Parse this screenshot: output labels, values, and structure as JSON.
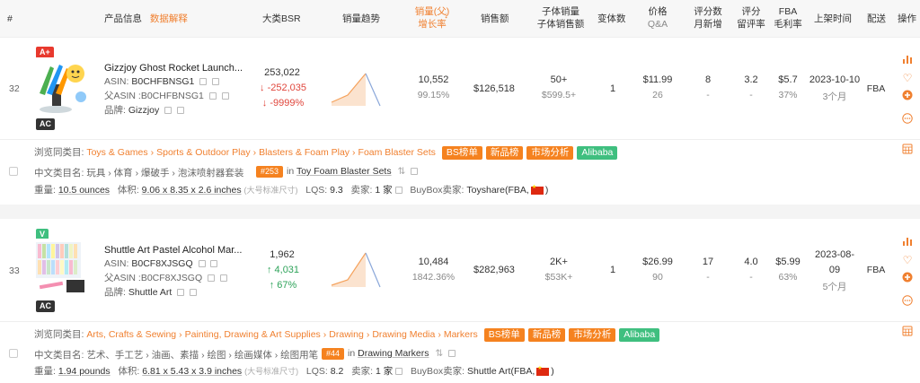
{
  "header": {
    "col_num": "#",
    "col_product": "产品信息",
    "col_product_link": "数据解释",
    "col_bsr": "大类BSR",
    "col_trend": "销量趋势",
    "col_sales_1": "销量(父)",
    "col_sales_2": "增长率",
    "col_revenue": "销售额",
    "col_child_1": "子体销量",
    "col_child_2": "子体销售额",
    "col_variants": "变体数",
    "col_price_1": "价格",
    "col_price_2": "Q&A",
    "col_reviews_1": "评分数",
    "col_reviews_2": "月新增",
    "col_rating_1": "评分",
    "col_rating_2": "留评率",
    "col_fba_1": "FBA",
    "col_fba_2": "毛利率",
    "col_date": "上架时间",
    "col_ship": "配送",
    "col_ops": "操作"
  },
  "rows": [
    {
      "index": "32",
      "grade_badge": "A+",
      "grade_color": "#e8392e",
      "ac_badge": "AC",
      "title": "Gizzjoy Ghost Rocket Launch...",
      "asin_label": "ASIN:",
      "asin": "B0CHFBNSG1",
      "parent_asin_label": "父ASIN :",
      "parent_asin": "B0CHFBNSG1",
      "brand_label": "品牌:",
      "brand": "Gizzjoy",
      "bsr": "253,022",
      "bsr_change": "-252,035",
      "bsr_pct": "-9999%",
      "bsr_dir": "down",
      "trend_points": [
        0,
        0,
        1,
        0
      ],
      "sales": "10,552",
      "growth": "99.15%",
      "revenue": "$126,518",
      "child_sales": "50+",
      "child_revenue": "$599.5+",
      "variants": "1",
      "price": "$11.99",
      "qa": "26",
      "reviews": "8",
      "reviews_new": "-",
      "rating": "3.2",
      "review_rate": "-",
      "fba": "$5.7",
      "margin": "37%",
      "date": "2023-10-10",
      "age": "3个月",
      "ship": "FBA",
      "browse_label": "浏览同类目:",
      "browse": [
        "Toys & Games",
        "Sports & Outdoor Play",
        "Blasters & Foam Play",
        "Foam Blaster Sets"
      ],
      "tags": [
        "BS榜单",
        "新品榜",
        "市场分析",
        "Alibaba"
      ],
      "cn_cat_label": "中文类目名:",
      "cn_cat": "玩具 › 体育 › 爆破手 › 泡沫喷射器套装",
      "rank_badge": "#253",
      "rank_in": "in",
      "rank_cat": "Toy Foam Blaster Sets",
      "weight_label": "重量:",
      "weight": "10.5 ounces",
      "volume_label": "体积:",
      "volume": "9.06 x 8.35 x 2.6 inches",
      "size_note": "(大号标准尺寸)",
      "lqs_label": "LQS:",
      "lqs": "9.3",
      "sellers_label": "卖家:",
      "sellers": "1 家",
      "buybox_label": "BuyBox卖家:",
      "buybox": "Toyshare(FBA,",
      "buybox_end": ")"
    },
    {
      "index": "33",
      "grade_badge": "V",
      "grade_color": "#3fbf7f",
      "ac_badge": "AC",
      "title": "Shuttle Art Pastel Alcohol Mar...",
      "asin_label": "ASIN:",
      "asin": "B0CF8XJSGQ",
      "parent_asin_label": "父ASIN :",
      "parent_asin": "B0CF8XJSGQ",
      "brand_label": "品牌:",
      "brand": "Shuttle Art",
      "bsr": "1,962",
      "bsr_change": "4,031",
      "bsr_pct": "67%",
      "bsr_dir": "up",
      "trend_points": [
        0,
        0,
        1,
        0
      ],
      "sales": "10,484",
      "growth": "1842.36%",
      "revenue": "$282,963",
      "child_sales": "2K+",
      "child_revenue": "$53K+",
      "variants": "1",
      "price": "$26.99",
      "qa": "90",
      "reviews": "17",
      "reviews_new": "-",
      "rating": "4.0",
      "review_rate": "-",
      "fba": "$5.99",
      "margin": "63%",
      "date_1": "2023-08-",
      "date_2": "09",
      "age": "5个月",
      "ship": "FBA",
      "browse_label": "浏览同类目:",
      "browse": [
        "Arts, Crafts & Sewing",
        "Painting, Drawing & Art Supplies",
        "Drawing",
        "Drawing Media",
        "Markers"
      ],
      "tags": [
        "BS榜单",
        "新品榜",
        "市场分析",
        "Alibaba"
      ],
      "cn_cat_label": "中文类目名:",
      "cn_cat": "艺术、手工艺 › 油画、素描 › 绘图 › 绘画媒体 › 绘图用笔",
      "rank_badge": "#44",
      "rank_in": "in",
      "rank_cat": "Drawing Markers",
      "weight_label": "重量:",
      "weight": "1.94 pounds",
      "volume_label": "体积:",
      "volume": "6.81 x 5.43 x 3.9 inches",
      "size_note": "(大号标准尺寸)",
      "lqs_label": "LQS:",
      "lqs": "8.2",
      "sellers_label": "卖家:",
      "sellers": "1 家",
      "buybox_label": "BuyBox卖家:",
      "buybox": "Shuttle Art(FBA,",
      "buybox_end": ")"
    }
  ],
  "colors": {
    "accent": "#f08030",
    "down": "#e0463c",
    "up": "#2ea35a",
    "trend_fill": "#fbe3cf",
    "trend_line": "#f5a25c",
    "trend_line2": "#8aa7d9"
  }
}
